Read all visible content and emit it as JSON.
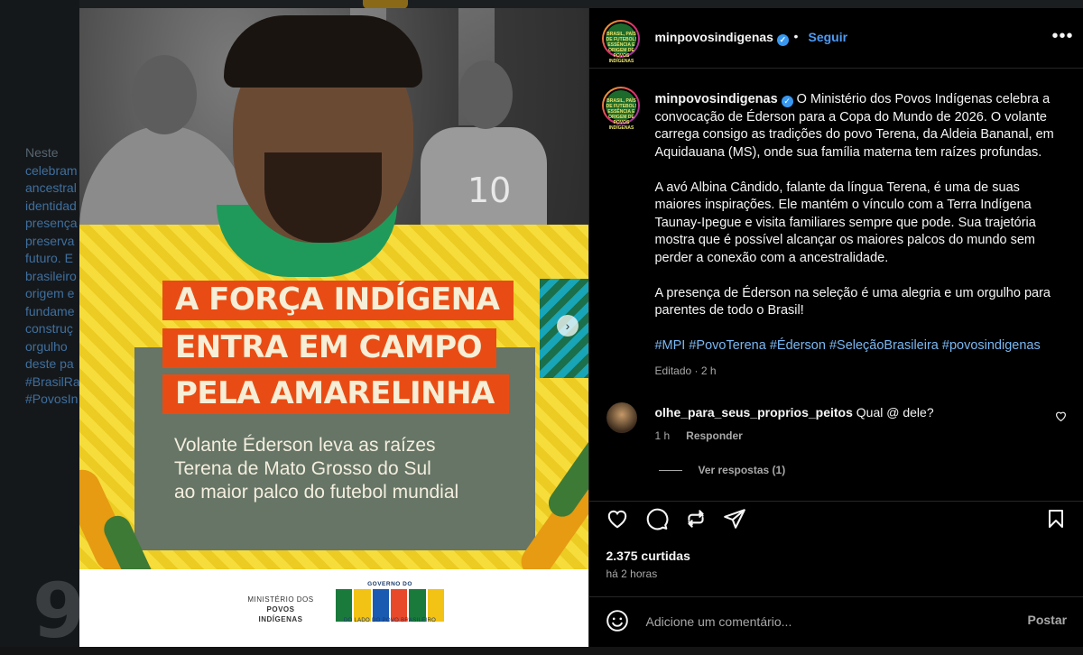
{
  "background": {
    "caption_fragment": [
      "Neste",
      "celebram",
      "ancestral",
      "identidad",
      "presença",
      "preserva",
      "futuro. E",
      "brasileiro",
      "origem e",
      "fundame",
      "construç",
      "orgulho",
      "deste pa",
      "#BrasilRa",
      "#PovosIn"
    ],
    "big_digit": "9"
  },
  "media": {
    "jersey_number": "10",
    "headline_lines": [
      "A FORÇA INDÍGENA",
      "ENTRA EM CAMPO",
      "PELA AMARELINHA"
    ],
    "subtitle_lines": [
      "Volante Éderson leva as raízes",
      "Terena de Mato Grosso do Sul",
      "ao maior palco do futebol mundial"
    ],
    "ministry_line1": "MINISTÉRIO DOS",
    "ministry_line2": "POVOS INDÍGENAS",
    "gov_small": "GOVERNO DO",
    "gov_word": "BRASIL",
    "gov_tagline": "DO LADO DO POVO BRASILEIRO",
    "next_icon": "chevron-right-icon"
  },
  "header": {
    "username": "minpovosindigenas",
    "dot": "•",
    "follow": "Seguir",
    "more": "•••",
    "avatar_text": "BRASIL, PAÍS DE FUTEBOL! ESSÊNCIA E ORIGEM DE POVOS INDÍGENAS"
  },
  "caption": {
    "username": "minpovosindigenas",
    "p1": " O Ministério dos Povos Indígenas celebra a convocação de Éderson para a Copa do Mundo de 2026. O volante carrega consigo as tradições do povo Terena, da Aldeia Bananal, em Aquidauana (MS), onde sua família materna tem raízes profundas.",
    "p2": "A avó Albina Cândido, falante da língua Terena, é uma de suas maiores inspirações. Ele mantém o vínculo com a Terra Indígena Taunay-Ipegue e visita familiares sempre que pode. Sua trajetória mostra que é possível alcançar os maiores palcos do mundo sem perder a conexão com a ancestralidade.",
    "p3": "A presença de Éderson na seleção é uma alegria e um orgulho para parentes de todo o Brasil!",
    "hashtags": [
      "#MPI",
      "#PovoTerena",
      "#Éderson",
      "#SeleçãoBrasileira",
      "#povosindigenas"
    ],
    "edited": "Editado · 2 h"
  },
  "comment": {
    "username": "olhe_para_seus_proprios_peitos",
    "text": " Qual @ dele?",
    "time": "1 h",
    "reply": "Responder",
    "view_replies": "Ver respostas (1)"
  },
  "actions": {
    "likes": "2.375 curtidas",
    "time": "há 2 horas"
  },
  "add_comment": {
    "placeholder": "Adicione um comentário...",
    "post": "Postar"
  },
  "colors": {
    "accent": "#4c9bf5",
    "tag_orange": "#e84c14",
    "card_green": "#667566",
    "shirt_yellow": "#f6dd3c"
  }
}
